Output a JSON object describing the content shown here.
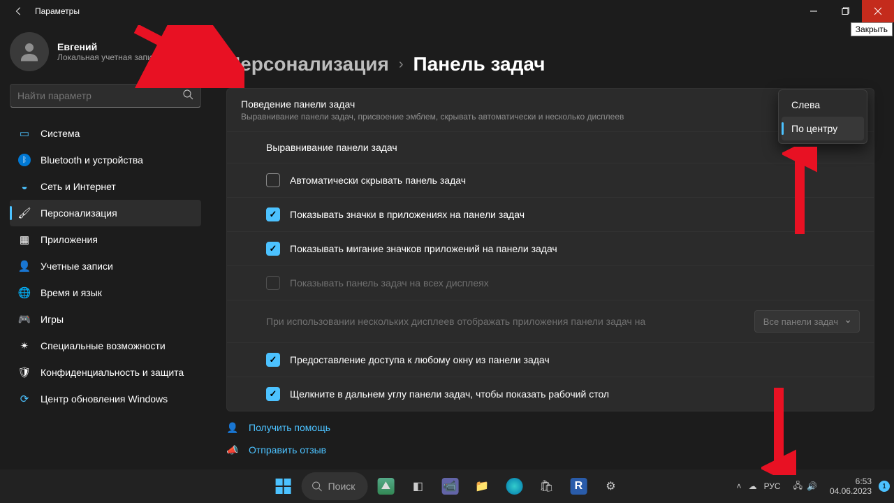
{
  "titlebar": {
    "title": "Параметры",
    "tooltip_close": "Закрыть"
  },
  "user": {
    "name": "Евгений",
    "sub": "Локальная учетная запись"
  },
  "search": {
    "placeholder": "Найти параметр"
  },
  "nav": [
    {
      "label": "Система"
    },
    {
      "label": "Bluetooth и устройства"
    },
    {
      "label": "Сеть и Интернет"
    },
    {
      "label": "Персонализация"
    },
    {
      "label": "Приложения"
    },
    {
      "label": "Учетные записи"
    },
    {
      "label": "Время и язык"
    },
    {
      "label": "Игры"
    },
    {
      "label": "Специальные возможности"
    },
    {
      "label": "Конфиденциальность и защита"
    },
    {
      "label": "Центр обновления Windows"
    }
  ],
  "crumb": {
    "root": "Персонализация",
    "leaf": "Панель задач"
  },
  "panel": {
    "header_title": "Поведение панели задач",
    "header_sub": "Выравнивание панели задач, присвоение эмблем, скрывать автоматически и несколько дисплеев",
    "row_align": "Выравнивание панели задач",
    "row_autohide": "Автоматически скрывать панель задач",
    "row_badges": "Показывать значки в приложениях на панели задач",
    "row_flash": "Показывать мигание значков приложений на панели задач",
    "row_alldisp": "Показывать панель задач на всех дисплеях",
    "row_multi": "При использовании нескольких дисплеев отображать приложения панели задач на",
    "row_anywin": "Предоставление доступа к любому окну из панели задач",
    "row_corner": "Щелкните в дальнем углу панели задач, чтобы показать рабочий стол",
    "dd_value": "Все панели задач"
  },
  "menu": {
    "opt1": "Слева",
    "opt2": "По центру"
  },
  "footer": {
    "help": "Получить помощь",
    "feedback": "Отправить отзыв"
  },
  "taskbar": {
    "search": "Поиск",
    "lang": "РУС",
    "time": "6:53",
    "date": "04.06.2023",
    "notif": "1"
  }
}
